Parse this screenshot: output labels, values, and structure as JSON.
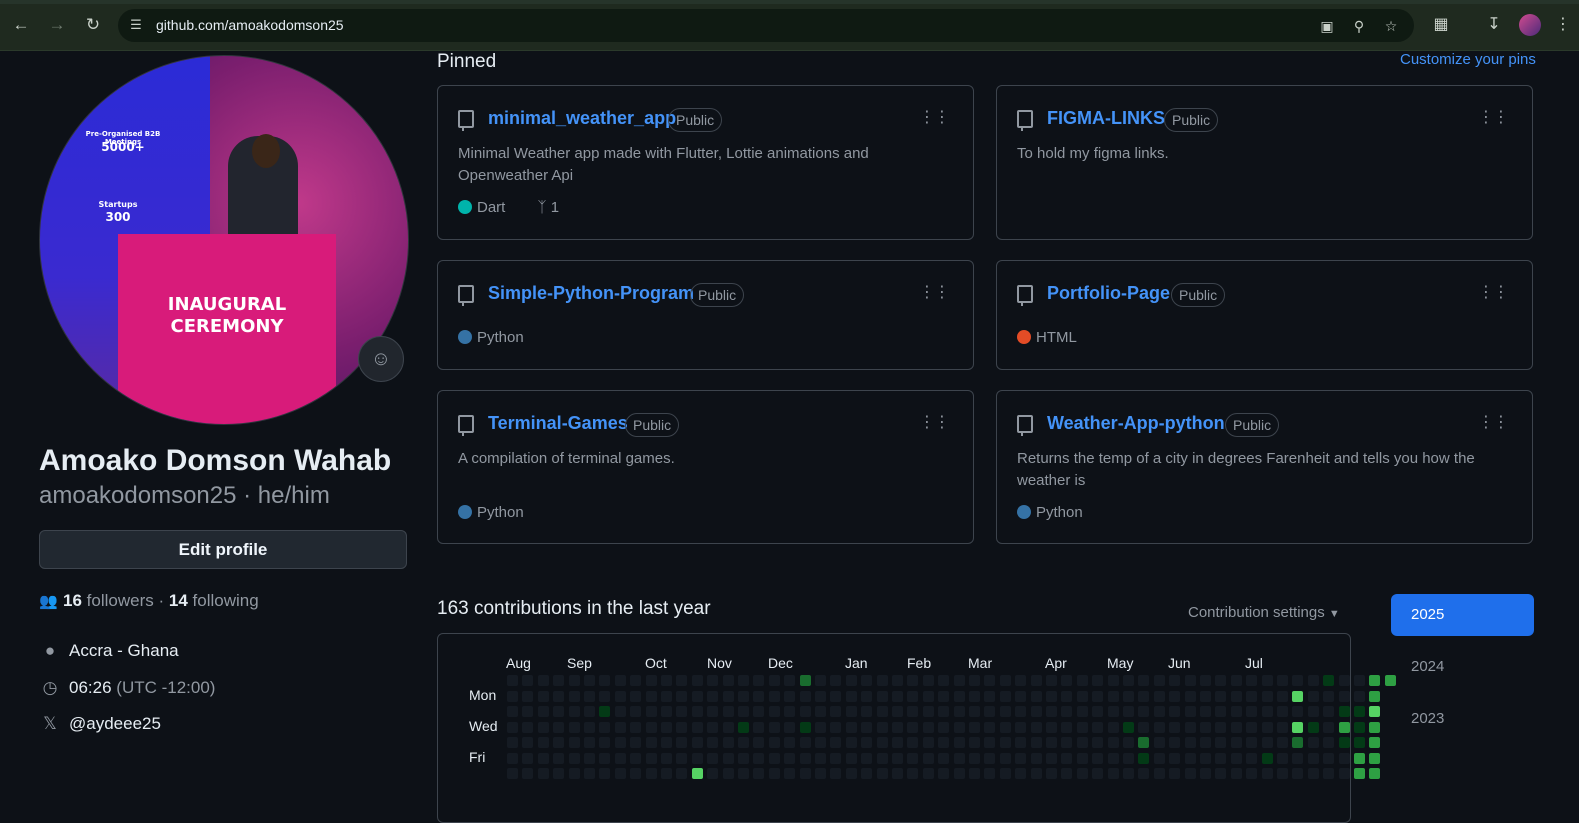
{
  "browser": {
    "url": "github.com/amoakodomson25",
    "back_icon": "arrow-left",
    "forward_icon": "arrow-right",
    "reload_icon": "reload",
    "site_info_icon": "tune"
  },
  "profile": {
    "full_name": "Amoako Domson Wahab",
    "login": "amoakodomson25 · he/him",
    "edit_label": "Edit profile",
    "followers_count": "16",
    "followers_label": "followers",
    "separator": "·",
    "following_count": "14",
    "following_label": "following",
    "location": "Accra - Ghana",
    "local_time": "06:26",
    "timezone": "(UTC -12:00)",
    "social": "@aydeee25",
    "avatar_texts": {
      "inaugural": "INAUGURAL",
      "ceremony": "CEREMONY",
      "meetings": "Pre-Organised B2B Meetings",
      "meetings_value": "5000+",
      "startups": "Startups",
      "startups_value": "300"
    }
  },
  "pinned": {
    "title": "Pinned",
    "customize_label": "Customize your pins",
    "repos": [
      {
        "name": "minimal_weather_app",
        "visibility": "Public",
        "description": "Minimal Weather app made with Flutter, Lottie animations and Openweather Api",
        "language": "Dart",
        "language_color": "#00b4ab",
        "forks": "1"
      },
      {
        "name": "FIGMA-LINKS",
        "visibility": "Public",
        "description": "To hold my figma links.",
        "language": "",
        "language_color": ""
      },
      {
        "name": "Simple-Python-Program",
        "visibility": "Public",
        "description": "",
        "language": "Python",
        "language_color": "#3572a5"
      },
      {
        "name": "Portfolio-Page",
        "visibility": "Public",
        "description": "",
        "language": "HTML",
        "language_color": "#e34c26"
      },
      {
        "name": "Terminal-Games",
        "visibility": "Public",
        "description": "A compilation of terminal games.",
        "language": "Python",
        "language_color": "#3572a5"
      },
      {
        "name": "Weather-App-python",
        "visibility": "Public",
        "description": "Returns the temp of a city in degrees Farenheit and tells you how the weather is",
        "language": "Python",
        "language_color": "#3572a5"
      }
    ]
  },
  "contributions": {
    "title": "163 contributions in the last year",
    "settings_label": "Contribution settings",
    "months": [
      "Aug",
      "Sep",
      "Oct",
      "Nov",
      "Dec",
      "Jan",
      "Feb",
      "Mar",
      "Apr",
      "May",
      "Jun",
      "Jul"
    ],
    "day_labels": [
      "Mon",
      "Wed",
      "Fri"
    ],
    "colors": {
      "empty": "#151b23",
      "l1": "#033a16",
      "l2": "#196c2e",
      "l3": "#2ea043",
      "l4": "#56d364"
    },
    "years": [
      "2025",
      "2024",
      "2023"
    ],
    "active_year": "2025",
    "activity": [
      {
        "week": 19,
        "day": 0,
        "level": 2
      },
      {
        "week": 6,
        "day": 2,
        "level": 1
      },
      {
        "week": 12,
        "day": 6,
        "level": 4
      },
      {
        "week": 15,
        "day": 3,
        "level": 1
      },
      {
        "week": 19,
        "day": 3,
        "level": 1
      },
      {
        "week": 40,
        "day": 3,
        "level": 1
      },
      {
        "week": 41,
        "day": 4,
        "level": 2
      },
      {
        "week": 41,
        "day": 5,
        "level": 1
      },
      {
        "week": 49,
        "day": 5,
        "level": 1
      },
      {
        "week": 51,
        "day": 1,
        "level": 4
      },
      {
        "week": 51,
        "day": 3,
        "level": 4
      },
      {
        "week": 51,
        "day": 4,
        "level": 2
      },
      {
        "week": 52,
        "day": 3,
        "level": 1
      },
      {
        "week": 53,
        "day": 0,
        "level": 1
      },
      {
        "week": 54,
        "day": 2,
        "level": 1
      },
      {
        "week": 54,
        "day": 3,
        "level": 3
      },
      {
        "week": 54,
        "day": 4,
        "level": 1
      },
      {
        "week": 55,
        "day": 2,
        "level": 1
      },
      {
        "week": 55,
        "day": 3,
        "level": 1
      },
      {
        "week": 55,
        "day": 4,
        "level": 1
      },
      {
        "week": 55,
        "day": 5,
        "level": 3
      },
      {
        "week": 55,
        "day": 6,
        "level": 3
      },
      {
        "week": 56,
        "day": 0,
        "level": 3
      },
      {
        "week": 56,
        "day": 1,
        "level": 3
      },
      {
        "week": 56,
        "day": 2,
        "level": 4
      },
      {
        "week": 56,
        "day": 3,
        "level": 3
      },
      {
        "week": 56,
        "day": 4,
        "level": 3
      },
      {
        "week": 56,
        "day": 5,
        "level": 3
      },
      {
        "week": 56,
        "day": 6,
        "level": 3
      },
      {
        "week": 57,
        "day": 0,
        "level": 3
      }
    ]
  }
}
